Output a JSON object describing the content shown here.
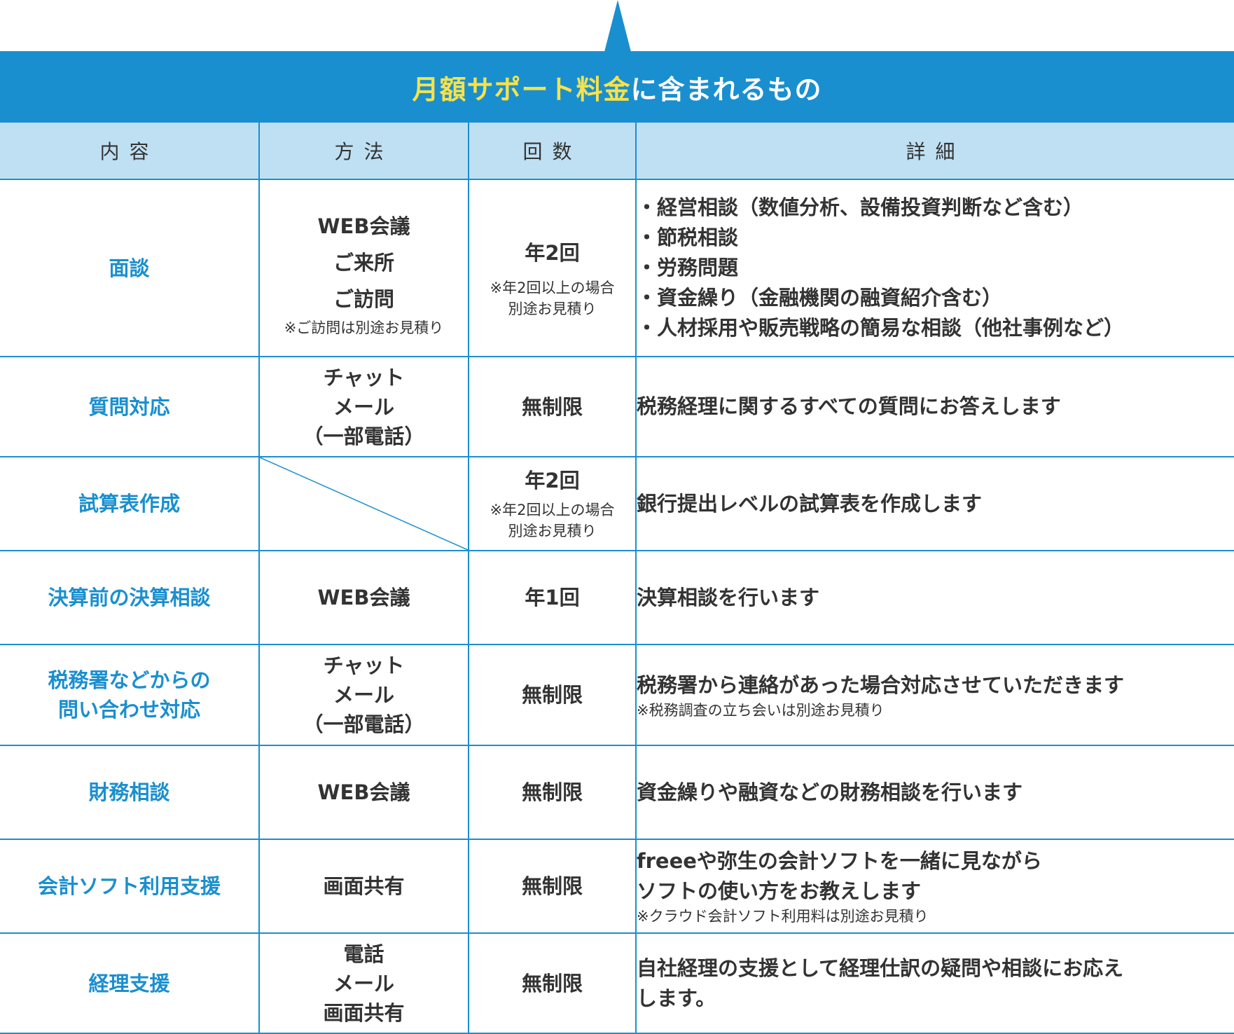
{
  "title_highlight": "月額サポート料金",
  "title_rest": "に含まれるもの",
  "headers": [
    "内容",
    "方法",
    "回数",
    "詳細"
  ],
  "rows": [
    {
      "item": [
        "面談"
      ],
      "method": [
        "WEB会議",
        "ご来所",
        "ご訪問"
      ],
      "method_note": "※ご訪問は別途お見積り",
      "count": "年2回",
      "count_note": [
        "※年2回以上の場合",
        "別途お見積り"
      ],
      "detail": [
        "・経営相談（数値分析、設備投資判断など含む）",
        "・節税相談",
        "・労務問題",
        "・資金繰り（金融機関の融資紹介含む）",
        "・人材採用や販売戦略の簡易な相談（他社事例など）"
      ]
    },
    {
      "item": [
        "質問対応"
      ],
      "method": [
        "チャット",
        "メール",
        "（一部電話）"
      ],
      "count": "無制限",
      "detail": [
        "税務経理に関するすべての質問にお答えします"
      ]
    },
    {
      "item": [
        "試算表作成"
      ],
      "method": [],
      "count": "年2回",
      "count_note": [
        "※年2回以上の場合",
        "別途お見積り"
      ],
      "detail": [
        "銀行提出レベルの試算表を作成します"
      ]
    },
    {
      "item": [
        "決算前の決算相談"
      ],
      "method": [
        "WEB会議"
      ],
      "count": "年1回",
      "detail": [
        "決算相談を行います"
      ]
    },
    {
      "item": [
        "税務署などからの",
        "問い合わせ対応"
      ],
      "method": [
        "チャット",
        "メール",
        "（一部電話）"
      ],
      "count": "無制限",
      "detail": [
        "税務署から連絡があった場合対応させていただきます"
      ],
      "detail_note": "※税務調査の立ち会いは別途お見積り"
    },
    {
      "item": [
        "財務相談"
      ],
      "method": [
        "WEB会議"
      ],
      "count": "無制限",
      "detail": [
        "資金繰りや融資などの財務相談を行います"
      ]
    },
    {
      "item": [
        "会計ソフト利用支援"
      ],
      "method": [
        "画面共有"
      ],
      "count": "無制限",
      "detail": [
        "freeeや弥生の会計ソフトを一緒に見ながら",
        "ソフトの使い方をお教えします"
      ],
      "detail_note": "※クラウド会計ソフト利用料は別途お見積り"
    },
    {
      "item": [
        "経理支援"
      ],
      "method": [
        "電話",
        "メール",
        "画面共有"
      ],
      "count": "無制限",
      "detail": [
        "自社経理の支援として経理仕訳の疑問や相談にお応え",
        "します。"
      ]
    }
  ],
  "colors": {
    "accent": "#1a8fcf",
    "header_bg": "#bfe0f3",
    "highlight": "#f7e24a",
    "text": "#333333"
  }
}
